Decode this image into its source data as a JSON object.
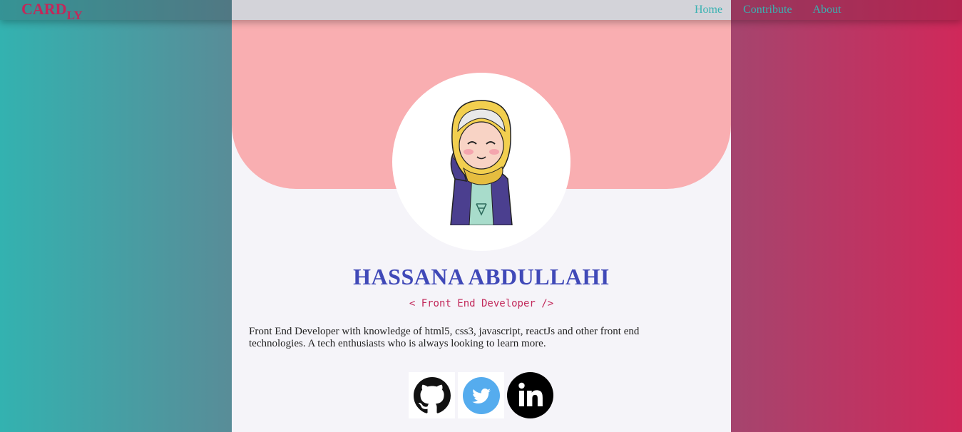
{
  "nav": {
    "logo_main": "CARD",
    "logo_sub": "LY",
    "links": [
      "Home",
      "Contribute",
      "About"
    ]
  },
  "profile": {
    "name": "HASSANA ABDULLAHI",
    "role": "< Front End Developer />",
    "bio": "Front End Developer with knowledge of html5, css3, javascript, reactJs and other front end technologies. A tech enthusiasts who is always looking to learn more."
  },
  "socials": [
    {
      "icon": "github-icon"
    },
    {
      "icon": "twitter-icon"
    },
    {
      "icon": "linkedin-icon"
    }
  ],
  "colors": {
    "accent_pink": "#c2285a",
    "name_blue": "#4049b8",
    "nav_teal": "#3ab2b2",
    "banner": "#f9aeb1",
    "twitter": "#55acee"
  }
}
